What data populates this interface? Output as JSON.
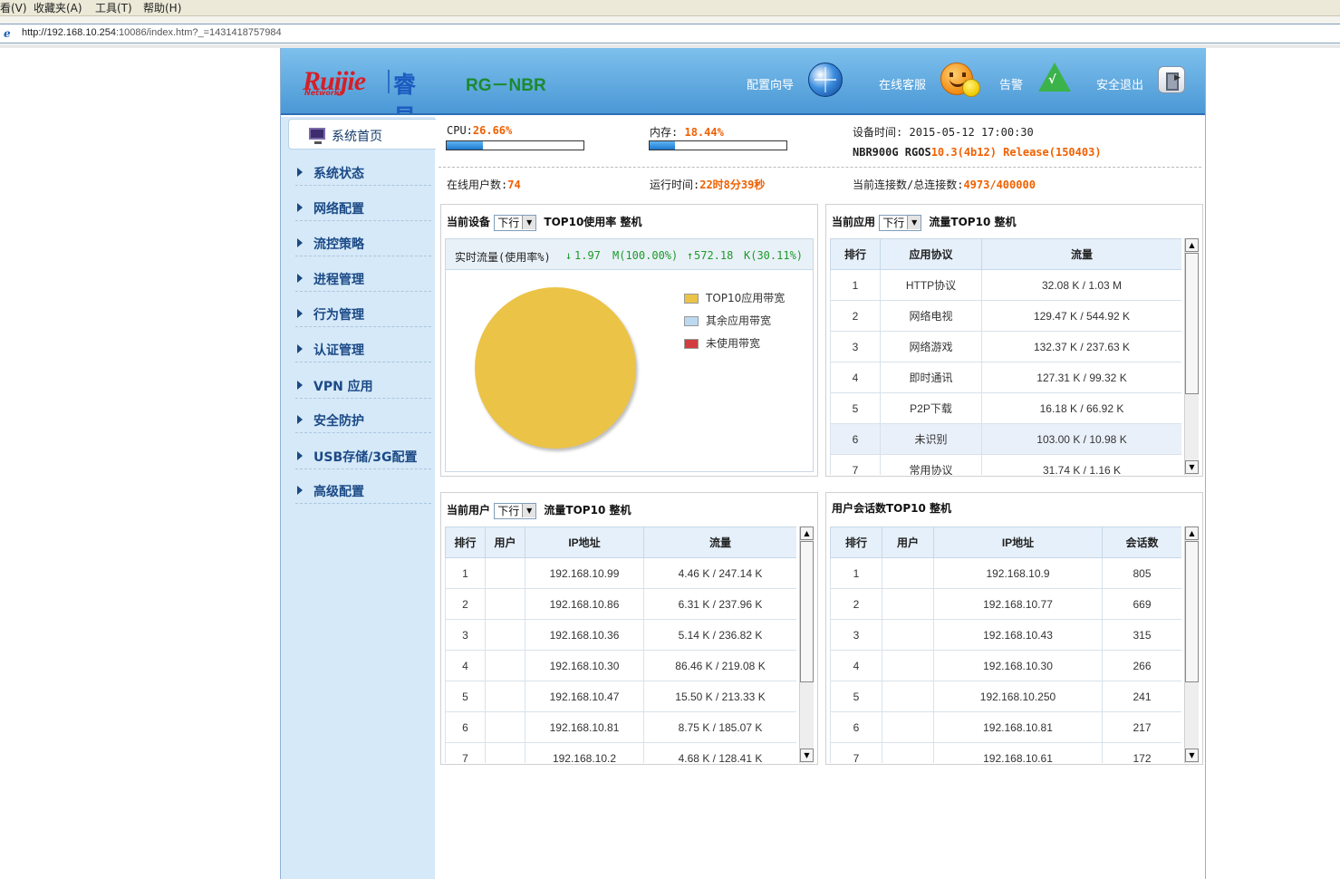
{
  "browser": {
    "menu": [
      "看(V)",
      "收藏夹(A)",
      "工具(T)",
      "帮助(H)"
    ],
    "url_main": "http://192.168.10.254",
    "url_rest": ":10086/index.htm?_=1431418757984"
  },
  "header": {
    "logo_main": "Ruijie",
    "logo_sub": "Networks",
    "logo_cn": "睿易",
    "product": "RG－NBR",
    "wizard": "配置向导",
    "service": "在线客服",
    "alarm": "告警",
    "logout": "安全退出"
  },
  "sidebar": {
    "home": "系统首页",
    "items": [
      "系统状态",
      "网络配置",
      "流控策略",
      "进程管理",
      "行为管理",
      "认证管理",
      "VPN 应用",
      "安全防护",
      "USB存储/3G配置",
      "高级配置"
    ]
  },
  "status": {
    "cpu_label": "CPU:",
    "cpu_value": "26.66%",
    "cpu_percent": 26.66,
    "mem_label": "内存:",
    "mem_value": "18.44%",
    "mem_percent": 18.44,
    "device_time_label": "设备时间:",
    "device_time": "2015-05-12 17:00:30",
    "model": "NBR900G RGOS",
    "version": "10.3(4b12) Release(150403)",
    "online_users_label": "在线用户数:",
    "online_users": "74",
    "uptime_label": "运行时间:",
    "uptime": "22时8分39秒",
    "conn_label": "当前连接数/总连接数:",
    "conn": "4973/400000"
  },
  "panel_device": {
    "prefix": "当前设备",
    "select": "下行",
    "suffix": "TOP10使用率 整机",
    "realtime_label": "实时流量(使用率%)",
    "down_arrow": "↓",
    "down_value": "1.97",
    "down_unit": "M(100.00%)",
    "up_arrow": "↑",
    "up_value": "572.18",
    "up_unit": "K(30.11%)",
    "legend": [
      {
        "label": "TOP10应用带宽",
        "color": "#ebc347"
      },
      {
        "label": "其余应用带宽",
        "color": "#bcd9f2"
      },
      {
        "label": "未使用带宽",
        "color": "#d23c3c"
      }
    ]
  },
  "panel_app": {
    "prefix": "当前应用",
    "select": "下行",
    "suffix": "流量TOP10 整机",
    "headers": [
      "排行",
      "应用协议",
      "流量"
    ],
    "rows": [
      [
        "1",
        "HTTP协议",
        "32.08 K / 1.03 M"
      ],
      [
        "2",
        "网络电视",
        "129.47 K / 544.92 K"
      ],
      [
        "3",
        "网络游戏",
        "132.37 K / 237.63 K"
      ],
      [
        "4",
        "即时通讯",
        "127.31 K / 99.32 K"
      ],
      [
        "5",
        "P2P下载",
        "16.18 K / 66.92 K"
      ],
      [
        "6",
        "未识别",
        "103.00 K / 10.98 K"
      ],
      [
        "7",
        "常用协议",
        "31.74 K / 1.16 K"
      ]
    ]
  },
  "panel_user": {
    "prefix": "当前用户",
    "select": "下行",
    "suffix": "流量TOP10 整机",
    "headers": [
      "排行",
      "用户",
      "IP地址",
      "流量"
    ],
    "rows": [
      [
        "1",
        "",
        "192.168.10.99",
        "4.46 K / 247.14 K"
      ],
      [
        "2",
        "",
        "192.168.10.86",
        "6.31 K / 237.96 K"
      ],
      [
        "3",
        "",
        "192.168.10.36",
        "5.14 K / 236.82 K"
      ],
      [
        "4",
        "",
        "192.168.10.30",
        "86.46 K / 219.08 K"
      ],
      [
        "5",
        "",
        "192.168.10.47",
        "15.50 K / 213.33 K"
      ],
      [
        "6",
        "",
        "192.168.10.81",
        "8.75 K / 185.07 K"
      ],
      [
        "7",
        "",
        "192.168.10.2",
        "4.68 K / 128.41 K"
      ]
    ]
  },
  "panel_session": {
    "title": "用户会话数TOP10 整机",
    "headers": [
      "排行",
      "用户",
      "IP地址",
      "会话数"
    ],
    "rows": [
      [
        "1",
        "",
        "192.168.10.9",
        "805"
      ],
      [
        "2",
        "",
        "192.168.10.77",
        "669"
      ],
      [
        "3",
        "",
        "192.168.10.43",
        "315"
      ],
      [
        "4",
        "",
        "192.168.10.30",
        "266"
      ],
      [
        "5",
        "",
        "192.168.10.250",
        "241"
      ],
      [
        "6",
        "",
        "192.168.10.81",
        "217"
      ],
      [
        "7",
        "",
        "192.168.10.61",
        "172"
      ]
    ]
  }
}
